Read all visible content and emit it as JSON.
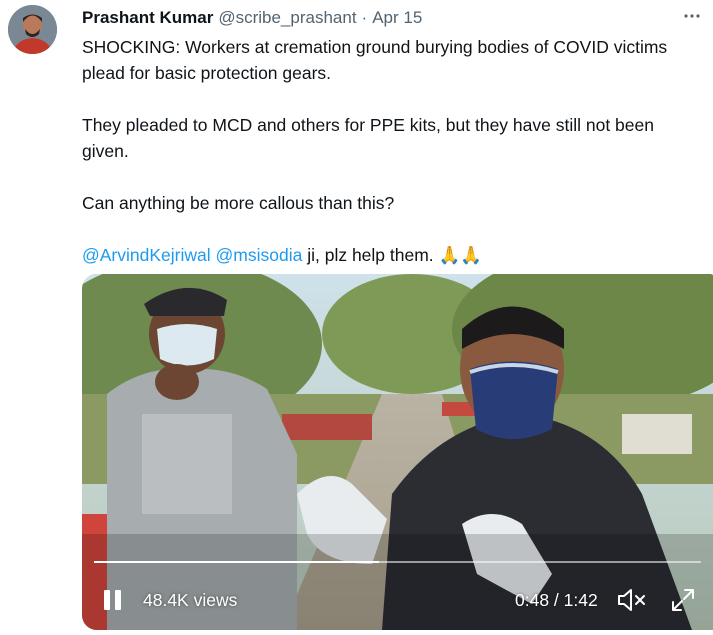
{
  "tweet": {
    "author_name": "Prashant Kumar",
    "author_handle": "@scribe_prashant",
    "separator": "·",
    "date": "Apr 15",
    "more_icon": "more-dots-icon",
    "paragraphs": [
      "SHOCKING: Workers at cremation ground burying bodies of COVID victims plead for basic protection gears.",
      "They pleaded to MCD and others for PPE kits, but they have still not been given.",
      "Can anything be more callous than this?"
    ],
    "last_line": {
      "mention_1": "@ArvindKejriwal",
      "mention_2": "@msisodia",
      "text": " ji, plz help them. 🙏🙏"
    }
  },
  "video": {
    "views": "48.4K views",
    "time": "0:48 / 1:42",
    "progress_fraction": 0.47,
    "icons": {
      "pause": "pause-icon",
      "mute": "muted-speaker-icon",
      "fullscreen": "fullscreen-icon"
    }
  },
  "colors": {
    "link": "#1d9bf0",
    "text": "#0f1419",
    "secondary": "#536471"
  }
}
